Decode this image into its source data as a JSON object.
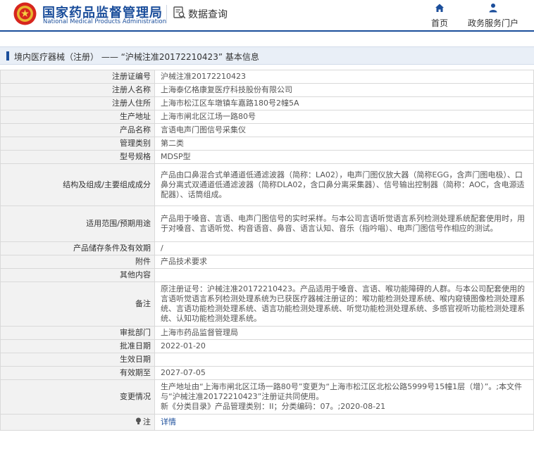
{
  "header": {
    "site_name": "国家药品监督管理局",
    "site_name_en": "National Medical Products Administration",
    "query_label": "数据查询",
    "nav": [
      {
        "label": "首页",
        "icon": "home-icon"
      },
      {
        "label": "政务服务门户",
        "icon": "user-icon"
      }
    ]
  },
  "breadcrumb": {
    "text": "境内医疗器械（注册） —— “沪械注准20172210423” 基本信息"
  },
  "details": [
    {
      "key": "注册证编号",
      "value": "沪械注准20172210423"
    },
    {
      "key": "注册人名称",
      "value": "上海泰亿格康复医疗科技股份有限公司"
    },
    {
      "key": "注册人住所",
      "value": "上海市松江区车墩镇车嘉路180号2幢5A"
    },
    {
      "key": "生产地址",
      "value": "上海市闸北区江场一路80号"
    },
    {
      "key": "产品名称",
      "value": "言语电声门图信号采集仪"
    },
    {
      "key": "管理类别",
      "value": "第二类"
    },
    {
      "key": "型号规格",
      "value": "MDSP型"
    },
    {
      "key": "结构及组成/主要组成成分",
      "value": "产品由口鼻混合式单通道低通滤波器（简称：LA02），电声门图仪放大器（简称EGG，含声门图电极）、口鼻分离式双通道低通滤波器（简称DLA02，含口鼻分离采集器）、信号输出控制器（简称：AOC，含电源适配器）、话筒组成。"
    },
    {
      "key": "适用范围/预期用途",
      "value": "产品用于嗓音、言语、电声门图信号的实时采样。与本公司言语听觉语言系列检测处理系统配套使用时，用于对嗓音、言语听觉、构音语音、鼻音、语言认知、音乐（指吟唱）、电声门图信号作相应的测试。"
    },
    {
      "key": "产品储存条件及有效期",
      "value": "/"
    },
    {
      "key": "附件",
      "value": "产品技术要求"
    },
    {
      "key": "其他内容",
      "value": ""
    },
    {
      "key": "备注",
      "value": "原注册证号：沪械注准20172210423。产品适用于嗓音、言语、喉功能障碍的人群。与本公司配套使用的言语听觉语言系列检测处理系统为已获医疗器械注册证的：喉功能检测处理系统、喉内窥镜图像检测处理系统、言语功能检测处理系统、语言功能检测处理系统、听觉功能检测处理系统、多感官视听功能检测处理系统、认知功能检测处理系统。"
    },
    {
      "key": "审批部门",
      "value": "上海市药品监督管理局"
    },
    {
      "key": "批准日期",
      "value": "2022-01-20"
    },
    {
      "key": "生效日期",
      "value": ""
    },
    {
      "key": "有效期至",
      "value": "2027-07-05"
    },
    {
      "key": "变更情况",
      "value_lines": [
        "生产地址由“上海市闸北区江场一路80号”变更为“上海市松江区北松公路5999号15幢1层（增）”。;本文件与“沪械注准20172210423”注册证共同使用。",
        "新《分类目录》产品管理类别：II；分类编码：07。;2020-08-21"
      ]
    },
    {
      "key": "注",
      "link": "详情"
    }
  ],
  "colors": {
    "brand_blue": "#1b4e9b",
    "emblem_red": "#d7261e",
    "label_bg": "#f2f2f2",
    "crumb_bg": "#e9eff7"
  }
}
